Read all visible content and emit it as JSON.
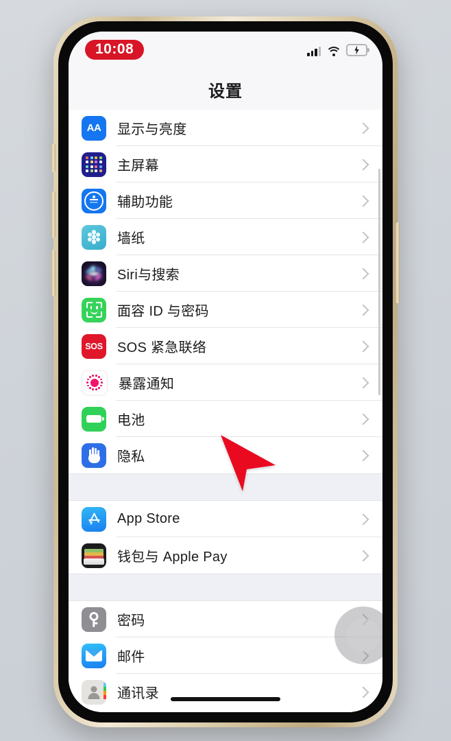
{
  "device": {
    "frame_color": "#d7c7a4",
    "bezel_color": "#090909",
    "background_color": "#d3d7dd"
  },
  "status_bar": {
    "time": "10:08",
    "time_pill_color": "#d81526",
    "signal_icon": "cellular-signal-icon",
    "signal_bars": 4,
    "signal_bars_active": 3,
    "wifi_icon": "wifi-icon",
    "battery_icon": "battery-charging-icon",
    "battery_charging": true
  },
  "nav": {
    "title": "设置"
  },
  "groups": [
    {
      "items": [
        {
          "label": "显示与亮度",
          "icon": "display-brightness-icon",
          "icon_color": "#1476f0",
          "chevron": "chevron-right-icon"
        },
        {
          "label": "主屏幕",
          "icon": "home-screen-icon",
          "icon_color": "#1f1f8e",
          "chevron": "chevron-right-icon"
        },
        {
          "label": "辅助功能",
          "icon": "accessibility-icon",
          "icon_color": "#1476f0",
          "chevron": "chevron-right-icon"
        },
        {
          "label": "墙纸",
          "icon": "wallpaper-icon",
          "icon_color": "#38aecb",
          "chevron": "chevron-right-icon"
        },
        {
          "label": "Siri与搜索",
          "icon": "siri-search-icon",
          "icon_color": "#201436",
          "chevron": "chevron-right-icon"
        },
        {
          "label": "面容 ID 与密码",
          "icon": "face-id-icon",
          "icon_color": "#36d35a",
          "chevron": "chevron-right-icon"
        },
        {
          "label": "SOS 紧急联络",
          "icon": "emergency-sos-icon",
          "icon_color": "#e0162b",
          "chevron": "chevron-right-icon"
        },
        {
          "label": "暴露通知",
          "icon": "exposure-notification-icon",
          "icon_color": "#f0156b",
          "chevron": "chevron-right-icon"
        },
        {
          "label": "电池",
          "icon": "battery-icon",
          "icon_color": "#30d158",
          "chevron": "chevron-right-icon"
        },
        {
          "label": "隐私",
          "icon": "privacy-hand-icon",
          "icon_color": "#2e6fe8",
          "chevron": "chevron-right-icon"
        }
      ]
    },
    {
      "items": [
        {
          "label": "App Store",
          "icon": "app-store-icon",
          "icon_color": "#1a7ff0",
          "chevron": "chevron-right-icon"
        },
        {
          "label": "钱包与 Apple Pay",
          "icon": "wallet-apple-pay-icon",
          "icon_color": "#1c1c1e",
          "chevron": "chevron-right-icon"
        }
      ]
    },
    {
      "items": [
        {
          "label": "密码",
          "icon": "passwords-key-icon",
          "icon_color": "#8e8e93",
          "chevron": "chevron-right-icon"
        },
        {
          "label": "邮件",
          "icon": "mail-envelope-icon",
          "icon_color": "#1a7ef2",
          "chevron": "chevron-right-icon"
        },
        {
          "label": "通讯录",
          "icon": "contacts-icon",
          "icon_color": "#e5e3df",
          "chevron": "chevron-right-icon"
        }
      ]
    }
  ],
  "overlays": {
    "assistive_touch": "assistive-touch-button",
    "home_indicator": "home-indicator-bar",
    "cursor": "mouse-cursor-arrow",
    "cursor_color": "#ea0a20",
    "scroll_indicator": "vertical-scroll-indicator"
  }
}
